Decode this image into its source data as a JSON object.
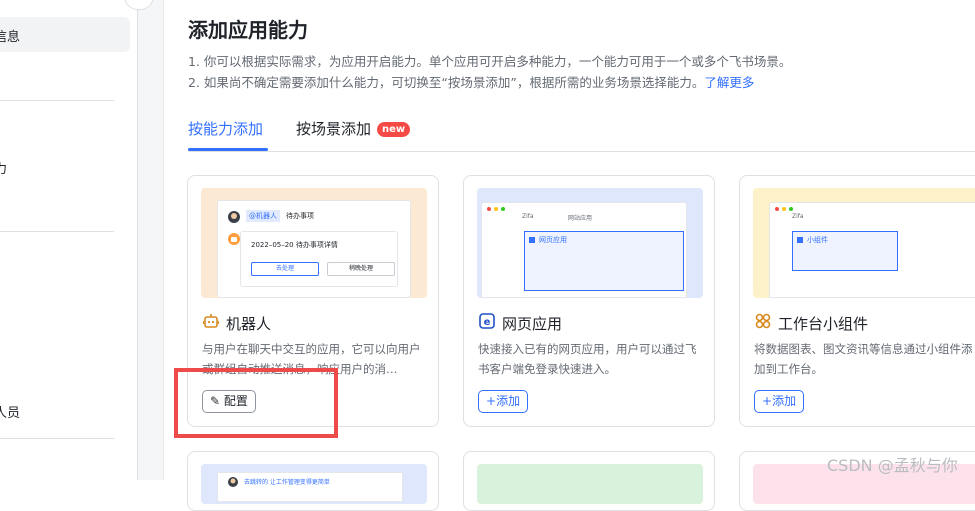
{
  "sidebar": {
    "items": [
      {
        "label": "信息"
      },
      {
        "label": "力"
      },
      {
        "label": "人员"
      }
    ]
  },
  "main": {
    "title": "添加应用能力",
    "desc1": "1. 你可以根据实际需求，为应用开启能力。单个应用可开启多种能力，一个能力可用于一个或多个飞书场景。",
    "desc2": "2. 如果尚不确定需要添加什么能力，可切换至“按场景添加”，根据所需的业务场景选择能力。",
    "learn_more": "了解更多",
    "tabs": [
      {
        "label": "按能力添加"
      },
      {
        "label": "按场景添加",
        "badge": "new"
      }
    ]
  },
  "cards": [
    {
      "title": "机器人",
      "icon": "robot-icon",
      "desc": "与用户在聊天中交互的应用，它可以向用户或群组自动推送消息，响应用户的消…",
      "button": "配置",
      "button_icon": "edit-icon",
      "preview": {
        "tag": "@机器人",
        "text": "待办事项",
        "line": "2022–05–20 待办事项详情",
        "btn1": "去处理",
        "btn2": "稍晚处理"
      }
    },
    {
      "title": "网页应用",
      "icon": "web-app-icon",
      "desc": "快速接入已有的网页应用，用户可以通过飞书客户端免登录快速进入。",
      "button": "添加",
      "button_icon": "plus-icon",
      "preview": {
        "label": "网页应用",
        "tab1": "Zifa",
        "tab2": "网站应用"
      }
    },
    {
      "title": "工作台小组件",
      "icon": "widget-icon",
      "desc": "将数据图表、图文资讯等信息通过小组件添加到工作台。",
      "button": "添加",
      "button_icon": "plus-icon",
      "preview": {
        "label": "小组件",
        "tab1": "Zifa"
      }
    }
  ],
  "bottom_preview": {
    "text": "去跳转的 让工作管理变得更简单"
  },
  "watermark": "CSDN @孟秋与你",
  "colors": {
    "accent": "#3370ff",
    "highlight": "#ef4a4a",
    "badge": "#f54a45"
  }
}
